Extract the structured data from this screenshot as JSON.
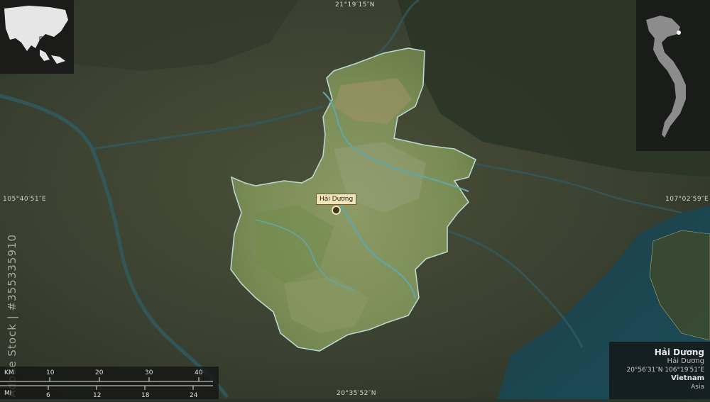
{
  "map": {
    "region_name": "Hải Dương",
    "region_native_name": "Hải Dương",
    "coordinates": "20°56′31″N 106°19′51″E",
    "country": "Vietnam",
    "continent": "Asia",
    "city_label": "Hải Dương",
    "colors": {
      "region_outline": "#b8d8d0",
      "inset_country": "#8c8c8c",
      "inset_highlight": "#ffffff",
      "label_bg": "#f2e3b8",
      "water": "#1f4a52"
    }
  },
  "graticule": {
    "top": "21°19′15″N",
    "bottom": "20°35′52″N",
    "left": "105°40′51″E",
    "right": "107°02′59″E"
  },
  "scalebar": {
    "km_label": "KM",
    "mi_label": "MI",
    "km_ticks": [
      "10",
      "20",
      "30",
      "40"
    ],
    "mi_ticks": [
      "6",
      "12",
      "18",
      "24"
    ]
  },
  "watermark": "Adobe Stock | #355335910",
  "icons": {
    "locator_map": "asia-locator-icon",
    "country_map": "vietnam-country-icon",
    "city_marker": "city-dot-icon"
  }
}
